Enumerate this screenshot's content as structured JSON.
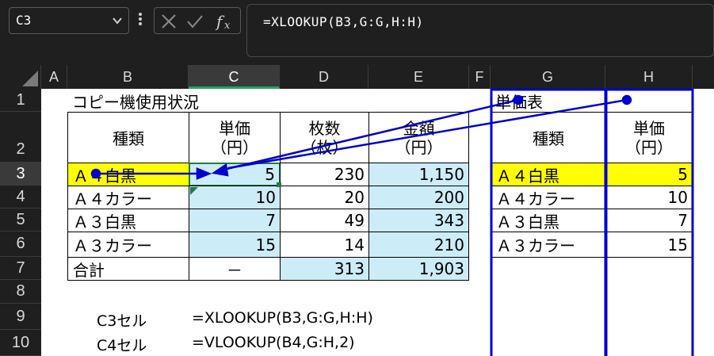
{
  "name_box": {
    "value": "C3"
  },
  "formula_bar": {
    "value": "=XLOOKUP(B3,G:G,H:H)"
  },
  "columns": [
    "A",
    "B",
    "C",
    "D",
    "E",
    "F",
    "G",
    "H"
  ],
  "rows": [
    "1",
    "2",
    "3",
    "4",
    "5",
    "6",
    "7",
    "8",
    "9",
    "10"
  ],
  "sheet": {
    "title": "コピー機使用状況",
    "headers": {
      "kind": "種類",
      "unit_price_1": "単価",
      "unit_price_2": "（円）",
      "count_1": "枚数",
      "count_2": "（枚）",
      "amount_1": "金額",
      "amount_2": "（円）"
    },
    "data_rows": [
      {
        "kind": "Ａ４白黒",
        "price": "5",
        "count": "230",
        "amount": "1,150"
      },
      {
        "kind": "Ａ４カラー",
        "price": "10",
        "count": "20",
        "amount": "200"
      },
      {
        "kind": "Ａ３白黒",
        "price": "7",
        "count": "49",
        "amount": "343"
      },
      {
        "kind": "Ａ３カラー",
        "price": "15",
        "count": "14",
        "amount": "210"
      }
    ],
    "total": {
      "label": "合計",
      "price": "－",
      "count": "313",
      "amount": "1,903"
    },
    "price_table": {
      "title": "単価表",
      "header_kind": "種類",
      "header_price_1": "単価",
      "header_price_2": "（円）",
      "rows": [
        {
          "kind": "Ａ４白黒",
          "price": "5"
        },
        {
          "kind": "Ａ４カラー",
          "price": "10"
        },
        {
          "kind": "Ａ３白黒",
          "price": "7"
        },
        {
          "kind": "Ａ３カラー",
          "price": "15"
        }
      ]
    },
    "notes": [
      {
        "cell": "C3セル",
        "formula": "=XLOOKUP(B3,G:G,H:H)"
      },
      {
        "cell": "C4セル",
        "formula": "=VLOOKUP(B4,G:H,2)"
      }
    ]
  },
  "colors": {
    "highlight": "#ffff00",
    "calc_fill": "#ccecf8",
    "trace_arrow": "#0000cc",
    "selection": "#21a366"
  }
}
